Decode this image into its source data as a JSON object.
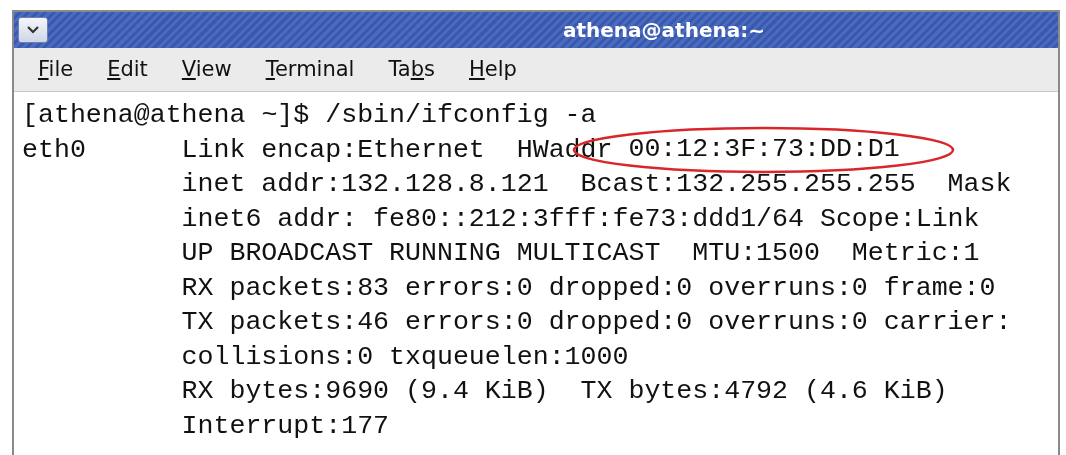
{
  "window": {
    "title": "athena@athena:~"
  },
  "menu": [
    {
      "parts": [
        {
          "text": "F",
          "underlined": true
        },
        {
          "text": "ile",
          "underlined": false
        }
      ]
    },
    {
      "parts": [
        {
          "text": "E",
          "underlined": true
        },
        {
          "text": "dit",
          "underlined": false
        }
      ]
    },
    {
      "parts": [
        {
          "text": "V",
          "underlined": true
        },
        {
          "text": "iew",
          "underlined": false
        }
      ]
    },
    {
      "parts": [
        {
          "text": "T",
          "underlined": true
        },
        {
          "text": "erminal",
          "underlined": false
        }
      ]
    },
    {
      "parts": [
        {
          "text": "Ta",
          "underlined": false
        },
        {
          "text": "b",
          "underlined": true
        },
        {
          "text": "s",
          "underlined": false
        }
      ]
    },
    {
      "parts": [
        {
          "text": "H",
          "underlined": true
        },
        {
          "text": "elp",
          "underlined": false
        }
      ]
    }
  ],
  "terminal": {
    "prompt_line": "[athena@athena ~]$ /sbin/ifconfig -a",
    "output": [
      {
        "interface": "eth0",
        "text": "Link encap:Ethernet  HWaddr",
        "value": "00:12:3F:73:DD:D1",
        "annotation": {
          "kind": "ellipse"
        }
      },
      {
        "text": "inet addr:132.128.8.121  Bcast:132.255.255.255  Mask"
      },
      {
        "text": "inet6 addr: fe80::212:3fff:fe73:ddd1/64 Scope:Link"
      },
      {
        "text": "UP BROADCAST RUNNING MULTICAST  MTU:1500  Metric:1"
      },
      {
        "text": "RX packets:83 errors:0 dropped:0 overruns:0 frame:0"
      },
      {
        "text": "TX packets:46 errors:0 dropped:0 overruns:0 carrier:"
      },
      {
        "text": "collisions:0 txqueuelen:1000"
      },
      {
        "text": "RX bytes:9690 (9.4 KiB)  TX bytes:4792 (4.6 KiB)"
      },
      {
        "text": "Interrupt:177"
      }
    ]
  }
}
